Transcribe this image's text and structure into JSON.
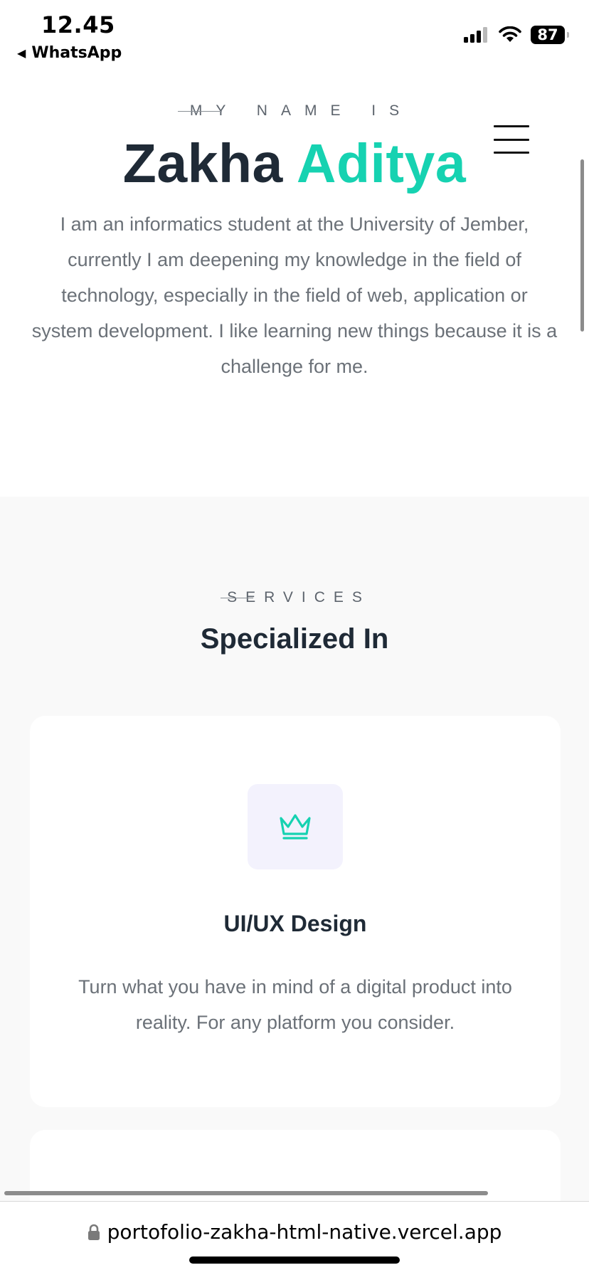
{
  "status_bar": {
    "time": "12.45",
    "back_app": "WhatsApp",
    "battery_level": "87"
  },
  "hero": {
    "intro_label": "MY NAME IS",
    "name_first": "Zakha",
    "name_accent": "Aditya",
    "bio": "I am an informatics student at the University of Jember, currently I am deepening my knowledge in the field of technology, especially in the field of web, application or system development. I like learning new things because it is a challenge for me."
  },
  "services": {
    "label": "SERVICES",
    "title": "Specialized In",
    "cards": [
      {
        "icon": "crown-icon",
        "title": "UI/UX Design",
        "description": "Turn what you have in mind of a digital product into reality. For any platform you consider."
      }
    ]
  },
  "browser": {
    "url": "portofolio-zakha-html-native.vercel.app"
  },
  "colors": {
    "accent": "#16d2b1",
    "heading": "#1f2a36",
    "body_text": "#6b7178",
    "section_bg": "#f9f9f9",
    "icon_box_bg": "#f3f2fd"
  }
}
